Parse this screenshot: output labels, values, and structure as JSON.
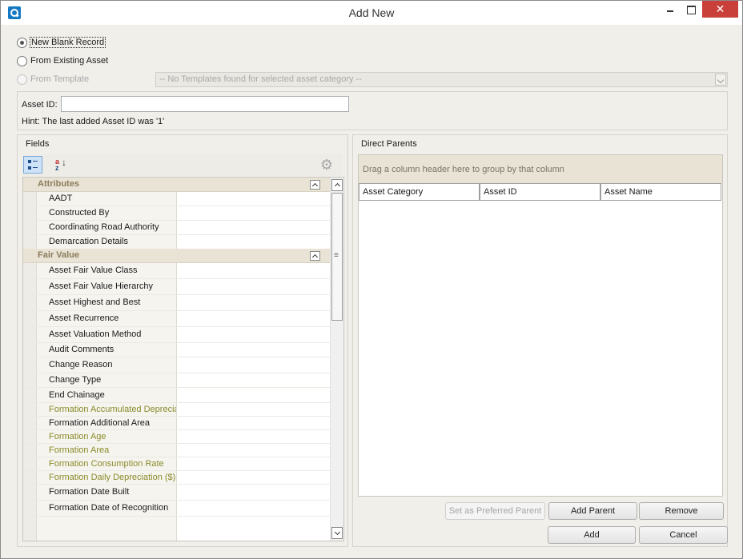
{
  "window": {
    "title": "Add New"
  },
  "options": {
    "new_blank": "New Blank Record",
    "from_existing": "From Existing Asset",
    "from_template": "From Template",
    "template_placeholder": "-- No Templates found for selected asset category --"
  },
  "asset_id": {
    "label": "Asset ID:",
    "value": "",
    "hint": "Hint: The last added Asset ID was '1'"
  },
  "fields": {
    "title": "Fields",
    "categories": [
      {
        "name": "Attributes",
        "rows": [
          {
            "label": "AADT"
          },
          {
            "label": "Constructed By"
          },
          {
            "label": "Coordinating Road Authority"
          },
          {
            "label": "Demarcation Details"
          }
        ]
      },
      {
        "name": "Fair Value",
        "rows": [
          {
            "label": "Asset Fair Value Class"
          },
          {
            "label": "Asset Fair Value Hierarchy"
          },
          {
            "label": "Asset Highest and Best"
          },
          {
            "label": "Asset Recurrence"
          },
          {
            "label": "Asset Valuation Method"
          },
          {
            "label": "Audit Comments"
          },
          {
            "label": "Change Reason"
          },
          {
            "label": "Change Type"
          },
          {
            "label": "End Chainage"
          },
          {
            "label": "Formation Accumulated Depreciat"
          },
          {
            "label": "Formation Additional Area"
          },
          {
            "label": "Formation Age"
          },
          {
            "label": "Formation Area"
          },
          {
            "label": "Formation Consumption Rate"
          },
          {
            "label": "Formation Daily Depreciation ($)"
          },
          {
            "label": "Formation Date Built"
          },
          {
            "label": "Formation Date of Recognition"
          }
        ]
      }
    ]
  },
  "parents": {
    "title": "Direct Parents",
    "group_hint": "Drag a column header here to group by that column",
    "columns": [
      "Asset Category",
      "Asset ID",
      "Asset Name"
    ],
    "set_preferred": "Set as Preferred Parent",
    "add_parent": "Add Parent",
    "remove": "Remove"
  },
  "footer": {
    "add": "Add",
    "cancel": "Cancel"
  },
  "colors": {
    "accent": "#1479c4",
    "close": "#c9403a",
    "readonly_text": "#8a8b2a",
    "category_text": "#8b7b5c"
  }
}
